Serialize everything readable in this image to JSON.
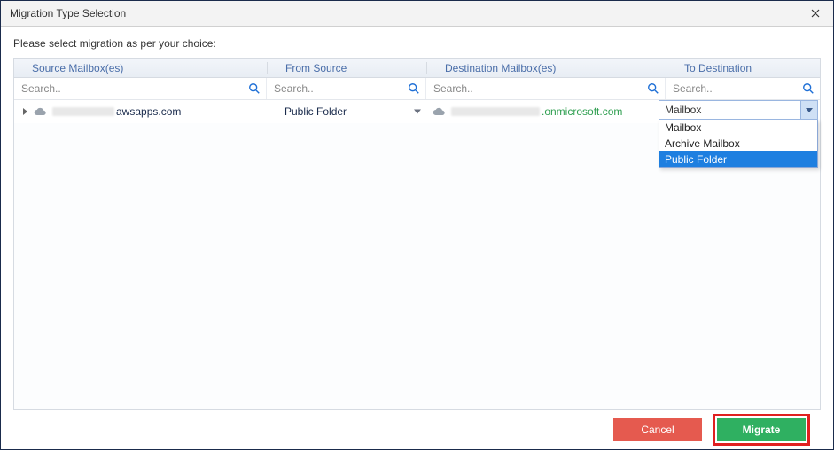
{
  "window": {
    "title": "Migration Type Selection"
  },
  "instruction": "Please select migration as per your choice:",
  "columns": {
    "source_mailboxes": "Source Mailbox(es)",
    "from_source": "From Source",
    "destination_mailboxes": "Destination Mailbox(es)",
    "to_destination": "To Destination"
  },
  "search_placeholder": "Search..",
  "row": {
    "source_domain_suffix": "awsapps.com",
    "from_source_value": "Public Folder",
    "dest_domain_suffix": ".onmicrosoft.com"
  },
  "to_destination_combo": {
    "selected": "Mailbox",
    "options": [
      "Mailbox",
      "Archive Mailbox",
      "Public Folder"
    ],
    "highlighted_index": 2
  },
  "buttons": {
    "cancel": "Cancel",
    "migrate": "Migrate"
  }
}
